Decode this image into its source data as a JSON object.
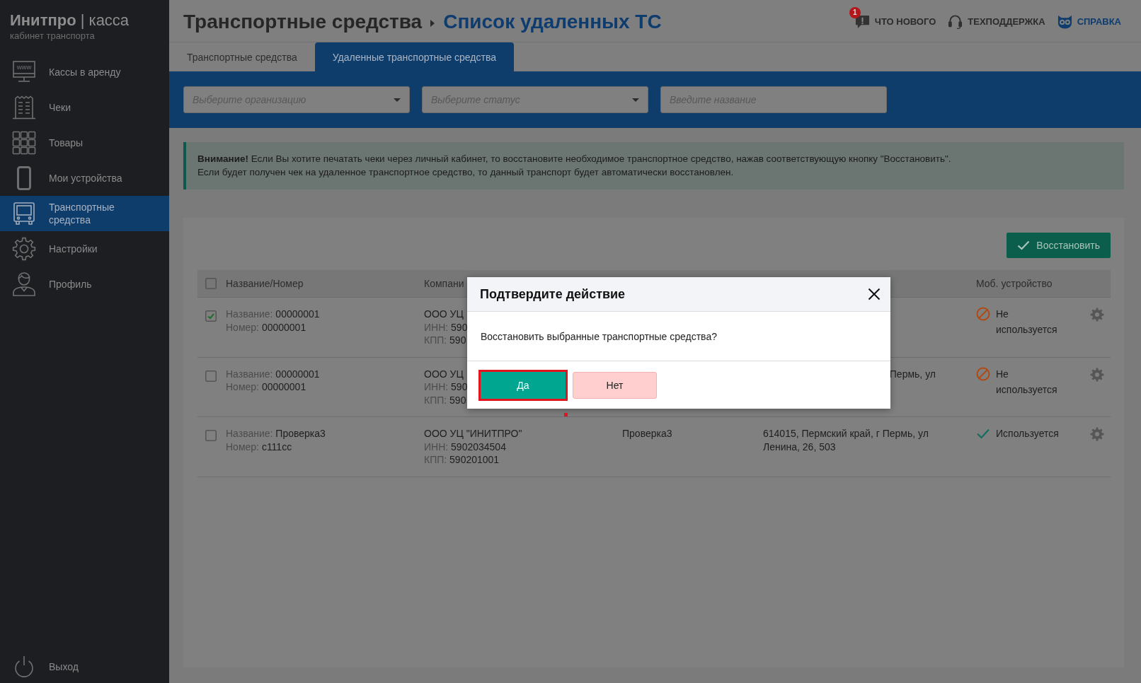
{
  "sidebar": {
    "logo": "**Инитпро** | касса",
    "subtitle": "кабинет транспорта",
    "items": [
      {
        "label": "Кассы в аренду",
        "icon_text": "www",
        "selected": false
      },
      {
        "label": "Чеки",
        "selected": false
      },
      {
        "label": "Товары",
        "selected": false
      },
      {
        "label": "Мои устройства",
        "selected": false
      },
      {
        "label": "Транспортные средства",
        "selected": true
      },
      {
        "label": "Настройки",
        "selected": false
      },
      {
        "label": "Профиль",
        "selected": false
      }
    ],
    "logout": "Выход"
  },
  "header": {
    "breadcrumb": "Транспортные средства",
    "title": "Список удаленных ТС",
    "links": [
      {
        "label": "ЧТО НОВОГО",
        "badge": "1",
        "color": "#2b2b2b"
      },
      {
        "label": "ТЕХПОДДЕРЖКА",
        "color": "#2b2b2b"
      },
      {
        "label": "СПРАВКА",
        "color": "#0f3c6e"
      }
    ]
  },
  "tabs": [
    {
      "label": "Транспортные средства",
      "selected": false
    },
    {
      "label": "Удаленные транспортные средства",
      "selected": true
    }
  ],
  "filters": [
    {
      "kind": "select",
      "placeholder": "Выберите организацию"
    },
    {
      "kind": "select",
      "placeholder": "Выберите статус"
    },
    {
      "kind": "text",
      "placeholder": "Введите название"
    }
  ],
  "alert": {
    "lines": [
      "**Внимание!** Если Вы хотите печатать чеки через личный кабинет, то восстановите необходимое транспортное средство, нажав соответствующую кнопку \"Восстановить\".",
      "Если будет получен чек на удаленное транспортное средство, то данный транспорт будет автоматически восстановлен."
    ]
  },
  "toolbar": {
    "restore_button": "Восстановить"
  },
  "table": {
    "header": {
      "checked": false,
      "name": "Название/Номер",
      "company": "Компани",
      "mobile": "Моб. устройство"
    },
    "rows": [
      {
        "checked": true,
        "vehicle": [
          {
            "label": "Название:",
            "value": "00000001"
          },
          {
            "label": "Номер:",
            "value": "00000001"
          }
        ],
        "company": [
          {
            "value": "ООО УЦ"
          },
          {
            "label": "ИНН:",
            "value": "590"
          },
          {
            "label": "КПП:",
            "value": "590"
          }
        ],
        "mobile": {
          "kind": "unused",
          "text": "Не используется"
        }
      },
      {
        "checked": false,
        "vehicle": [
          {
            "label": "Название:",
            "value": "00000001"
          },
          {
            "label": "Номер:",
            "value": "00000001"
          }
        ],
        "company": [
          {
            "value": "ООО УЦ"
          },
          {
            "label": "ИНН:",
            "value": "590"
          },
          {
            "label": "КПП:",
            "value": "590"
          }
        ],
        "column_4": {
          "text": "Пермь, ул",
          "covered": true
        },
        "mobile": {
          "kind": "unused",
          "text": "Не используется"
        }
      },
      {
        "checked": false,
        "vehicle": [
          {
            "label": "Название:",
            "value": "Проверка3"
          },
          {
            "label": "Номер:",
            "value": "с111сс"
          }
        ],
        "company": [
          {
            "value": "ООО УЦ \"ИНИТПРО\""
          },
          {
            "label": "ИНН:",
            "value": "5902034504"
          },
          {
            "label": "КПП:",
            "value": "590201001"
          }
        ],
        "column_3": "Проверка3",
        "column_4": {
          "text": "614015, Пермский край, г Пермь, ул Ленина, 26, 503",
          "covered": false
        },
        "mobile": {
          "kind": "used",
          "text": "Используется"
        }
      }
    ]
  },
  "dialog": {
    "title": "Подтвердите действие",
    "message": "Восстановить выбранные транспортные средства?",
    "marker": true,
    "buttons": [
      {
        "label": "Да",
        "kind": "confirm",
        "highlighted": true
      },
      {
        "label": "Нет",
        "kind": "cancel",
        "highlighted": false
      }
    ]
  }
}
